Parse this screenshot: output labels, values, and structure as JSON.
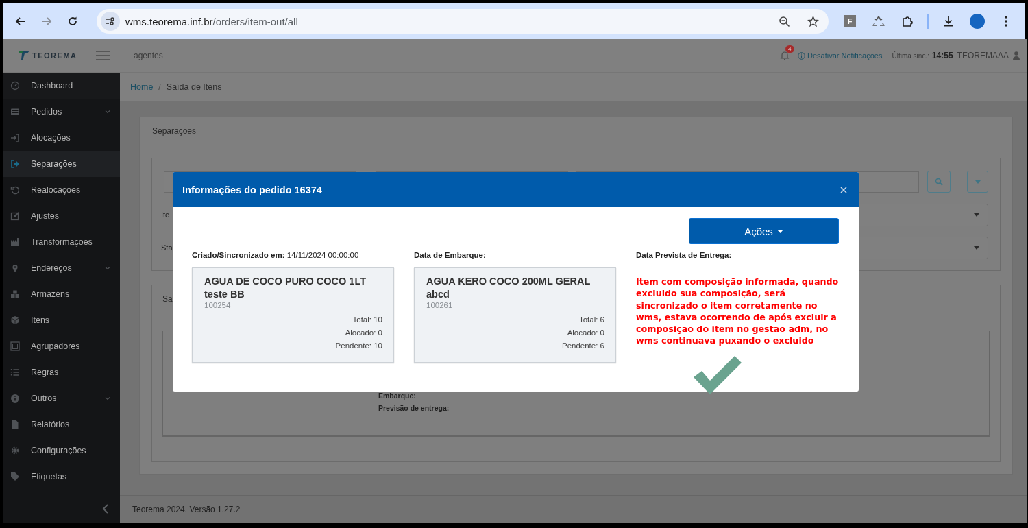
{
  "browser": {
    "url_host": "wms.teorema.inf.br",
    "url_path": "/orders/item-out/all",
    "extension_letter": "F"
  },
  "header": {
    "logo": "TEOREMA",
    "context": "agentes",
    "notification_count": "4",
    "notifications_link": "Desativar Notificações",
    "sync_label": "Última sinc.:",
    "sync_time": "14:55",
    "user": "TEOREMAAA"
  },
  "sidebar": {
    "items": [
      {
        "label": "Dashboard",
        "selected": false,
        "has_submenu": false
      },
      {
        "label": "Pedidos",
        "selected": false,
        "has_submenu": true
      },
      {
        "label": "Alocações",
        "selected": false,
        "has_submenu": false
      },
      {
        "label": "Separações",
        "selected": true,
        "has_submenu": false
      },
      {
        "label": "Realocações",
        "selected": false,
        "has_submenu": false
      },
      {
        "label": "Ajustes",
        "selected": false,
        "has_submenu": false
      },
      {
        "label": "Transformações",
        "selected": false,
        "has_submenu": false
      },
      {
        "label": "Endereços",
        "selected": false,
        "has_submenu": true
      },
      {
        "label": "Armazéns",
        "selected": false,
        "has_submenu": false
      },
      {
        "label": "Itens",
        "selected": false,
        "has_submenu": false
      },
      {
        "label": "Agrupadores",
        "selected": false,
        "has_submenu": false
      },
      {
        "label": "Regras",
        "selected": false,
        "has_submenu": false
      },
      {
        "label": "Outros",
        "selected": false,
        "has_submenu": true
      },
      {
        "label": "Relatórios",
        "selected": false,
        "has_submenu": false
      },
      {
        "label": "Configurações",
        "selected": false,
        "has_submenu": false
      },
      {
        "label": "Etiquetas",
        "selected": false,
        "has_submenu": false
      }
    ]
  },
  "breadcrumb": {
    "separator": "/",
    "items": [
      {
        "label": "Home",
        "link": true
      },
      {
        "label": "Saída de Itens",
        "link": false
      }
    ]
  },
  "page_card": {
    "title": "Separações",
    "filter_labels": [
      "Ite",
      "Sta"
    ],
    "tab_label": "Sa",
    "details": [
      "Embarque:",
      "Previsão de entrega:"
    ]
  },
  "modal": {
    "title": "Informações do pedido 16374",
    "actions_button": "Ações",
    "created_label": "Criado/Sincronizado em:",
    "created_value": "14/11/2024 00:00:00",
    "shipping_label": "Data de Embarque:",
    "delivery_label": "Data Prevista de Entrega:",
    "items": [
      {
        "name": "AGUA DE COCO PURO COCO 1LT teste BB",
        "code": "100254",
        "total": "Total: 10",
        "allocated": "Alocado: 0",
        "pending": "Pendente: 10"
      },
      {
        "name": "AGUA KERO COCO 200ML GERAL abcd",
        "code": "100261",
        "total": "Total: 6",
        "allocated": "Alocado: 0",
        "pending": "Pendente: 6"
      }
    ]
  },
  "annotation": {
    "text": "Item com composição informada, quando excluido sua composição, será sincronizado o item corretamente no wms, estava ocorrendo de após excluir a composição do item no gestão adm, no wms continuava puxando o excluido"
  },
  "footer": {
    "text": "Teorema 2024. Versão 1.27.2"
  }
}
